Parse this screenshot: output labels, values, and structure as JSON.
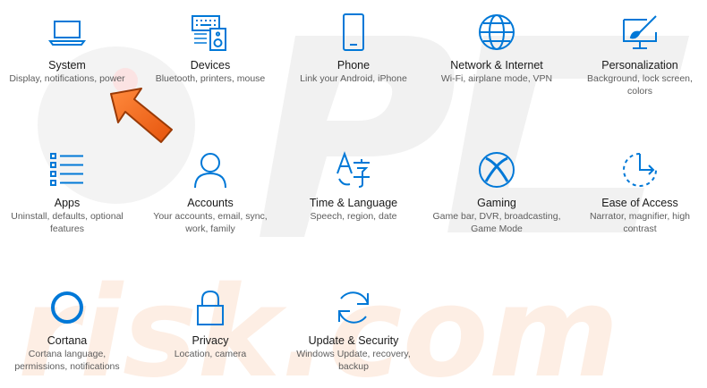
{
  "accent_color": "#0078d7",
  "watermark": {
    "line1": "PC",
    "line2": "risk.com"
  },
  "tiles": [
    {
      "title": "System",
      "desc": "Display, notifications, power",
      "icon": "laptop-icon"
    },
    {
      "title": "Devices",
      "desc": "Bluetooth, printers, mouse",
      "icon": "keyboard-speaker-icon"
    },
    {
      "title": "Phone",
      "desc": "Link your Android, iPhone",
      "icon": "phone-icon"
    },
    {
      "title": "Network & Internet",
      "desc": "Wi-Fi, airplane mode, VPN",
      "icon": "globe-icon"
    },
    {
      "title": "Personalization",
      "desc": "Background, lock screen, colors",
      "icon": "paint-screen-icon"
    },
    {
      "title": "Apps",
      "desc": "Uninstall, defaults, optional features",
      "icon": "apps-list-icon"
    },
    {
      "title": "Accounts",
      "desc": "Your accounts, email, sync, work, family",
      "icon": "person-icon"
    },
    {
      "title": "Time & Language",
      "desc": "Speech, region, date",
      "icon": "language-icon"
    },
    {
      "title": "Gaming",
      "desc": "Game bar, DVR, broadcasting, Game Mode",
      "icon": "xbox-icon"
    },
    {
      "title": "Ease of Access",
      "desc": "Narrator, magnifier, high contrast",
      "icon": "ease-of-access-icon"
    },
    {
      "title": "Cortana",
      "desc": "Cortana language, permissions, notifications",
      "icon": "cortana-icon"
    },
    {
      "title": "Privacy",
      "desc": "Location, camera",
      "icon": "lock-icon"
    },
    {
      "title": "Update & Security",
      "desc": "Windows Update, recovery, backup",
      "icon": "sync-icon"
    }
  ]
}
